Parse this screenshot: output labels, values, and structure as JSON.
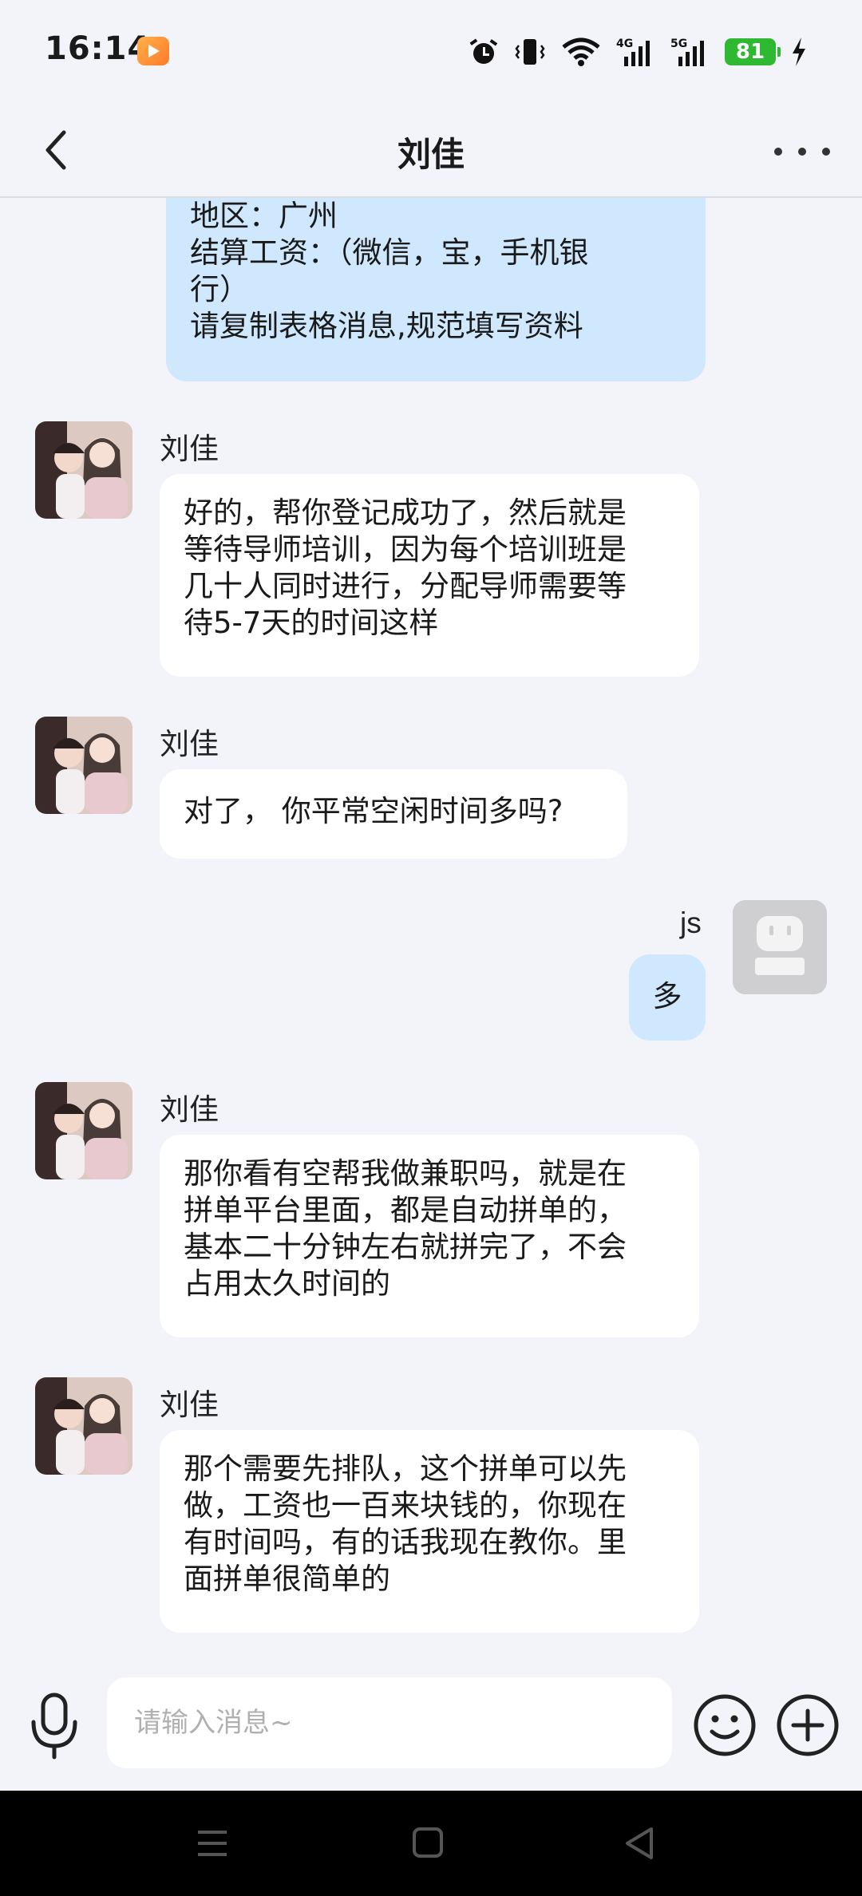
{
  "status_bar": {
    "time": "16:14",
    "battery": "81",
    "net1": "4G",
    "net2": "5G"
  },
  "header": {
    "title": "刘佳"
  },
  "messages": [
    {
      "side": "out",
      "sender": "",
      "lines": [
        "地区：广州",
        "结算工资：（微信，宝，手机银",
        "行）",
        "请复制表格消息,规范填写资料"
      ]
    },
    {
      "side": "in",
      "sender": "刘佳",
      "lines": [
        "好的，帮你登记成功了，然后就是",
        "等待导师培训，因为每个培训班是",
        "几十人同时进行，分配导师需要等",
        "待5-7天的时间这样"
      ]
    },
    {
      "side": "in",
      "sender": "刘佳",
      "lines": [
        "对了， 你平常空闲时间多吗?"
      ]
    },
    {
      "side": "out",
      "sender": "js",
      "lines": [
        "多"
      ]
    },
    {
      "side": "in",
      "sender": "刘佳",
      "lines": [
        "那你看有空帮我做兼职吗，就是在",
        "拼单平台里面，都是自动拼单的，",
        "基本二十分钟左右就拼完了，不会",
        "占用太久时间的"
      ]
    },
    {
      "side": "in",
      "sender": "刘佳",
      "lines": [
        "那个需要先排队，这个拼单可以先",
        "做，工资也一百来块钱的，你现在",
        "有时间吗，有的话我现在教你。里",
        "面拼单很简单的"
      ]
    }
  ],
  "input": {
    "placeholder": "请输入消息~"
  },
  "colors": {
    "background": "#f3f4f9",
    "bubble_in": "#ffffff",
    "bubble_out": "#cfe8fd",
    "battery": "#2fb832"
  },
  "icons": [
    "back-arrow-icon",
    "more-dots-icon",
    "microphone-icon",
    "emoji-icon",
    "plus-icon",
    "alarm-icon",
    "vibrate-icon",
    "wifi-icon",
    "signal-icon",
    "charging-icon",
    "menu-icon",
    "home-icon",
    "back-triangle-icon"
  ]
}
